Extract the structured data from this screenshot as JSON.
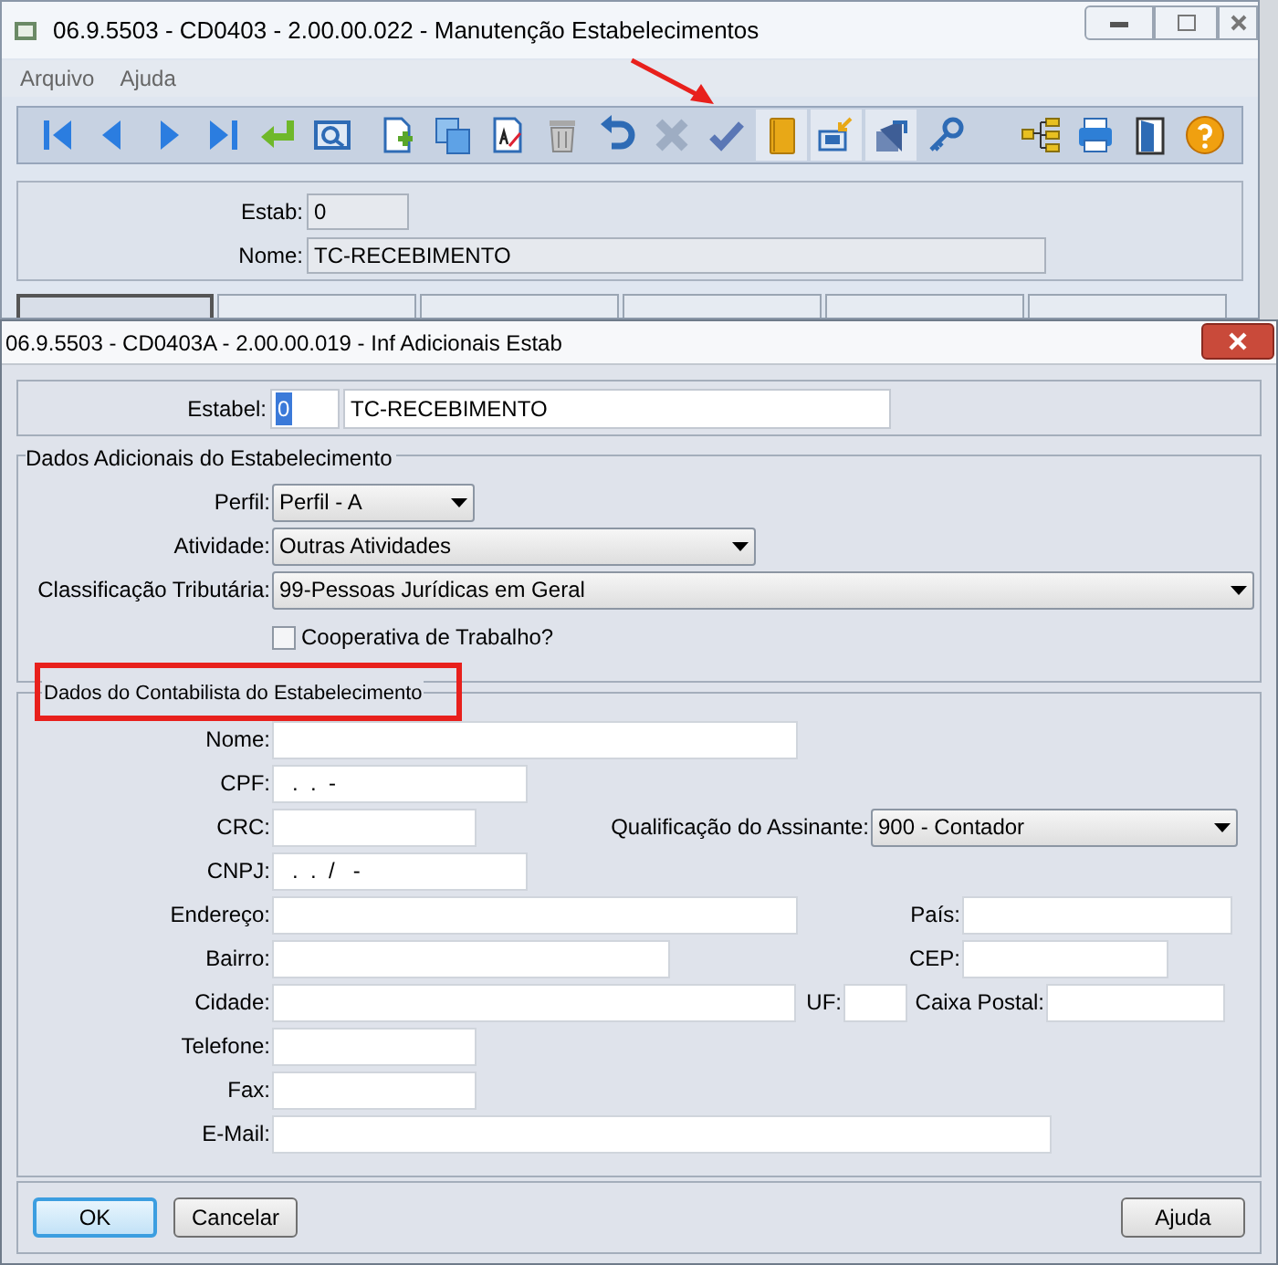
{
  "main_window": {
    "title": "06.9.5503 - CD0403 - 2.00.00.022 - Manutenção Estabelecimentos",
    "menu": [
      "Arquivo",
      "Ajuda"
    ],
    "estab": {
      "label": "Estab:",
      "value": "0"
    },
    "nome": {
      "label": "Nome:",
      "value": "TC-RECEBIMENTO"
    },
    "tabs": [
      {
        "selected": true
      },
      {
        "selected": false
      },
      {
        "selected": false
      },
      {
        "selected": false
      },
      {
        "selected": false
      },
      {
        "selected": false
      }
    ]
  },
  "dialog": {
    "title": "06.9.5503 - CD0403A - 2.00.00.019 - Inf Adicionais Estab",
    "estabel": {
      "label": "Estabel:",
      "code": "0",
      "name": "TC-RECEBIMENTO"
    },
    "adicionais": {
      "title": "Dados Adicionais do Estabelecimento",
      "fields": [
        {
          "label": "Perfil:",
          "value": "Perfil - A"
        },
        {
          "label": "Atividade:",
          "value": "Outras Atividades"
        },
        {
          "label": "Classificação Tributária:",
          "value": "99-Pessoas Jurídicas em Geral"
        }
      ],
      "cooperativa": {
        "label": "Cooperativa de Trabalho?",
        "checked": false
      }
    },
    "contabilista": {
      "title": "Dados do Contabilista do Estabelecimento",
      "highlighted": true,
      "rows": [
        [
          {
            "kind": "input",
            "label": "Nome:"
          }
        ],
        [
          {
            "kind": "input",
            "label": "CPF:",
            "value": ".  .  -"
          }
        ],
        [
          {
            "kind": "input",
            "label": "CRC:"
          },
          {
            "kind": "select",
            "label": "Qualificação do Assinante:",
            "value": "900 - Contador"
          }
        ],
        [
          {
            "kind": "input",
            "label": "CNPJ:",
            "value": ".  .  /   -"
          }
        ],
        [
          {
            "kind": "input",
            "label": "Endereço:"
          },
          {
            "kind": "input",
            "label": "País:"
          }
        ],
        [
          {
            "kind": "input",
            "label": "Bairro:"
          },
          {
            "kind": "input",
            "label": "CEP:"
          }
        ],
        [
          {
            "kind": "input",
            "label": "Cidade:"
          },
          {
            "kind": "input",
            "label": "UF:"
          },
          {
            "kind": "input",
            "label": "Caixa Postal:"
          }
        ],
        [
          {
            "kind": "input",
            "label": "Telefone:"
          }
        ],
        [
          {
            "kind": "input",
            "label": "Fax:"
          }
        ],
        [
          {
            "kind": "input",
            "label": "E-Mail:"
          }
        ]
      ]
    },
    "buttons": [
      {
        "label": "OK",
        "focused": true
      },
      {
        "label": "Cancelar",
        "focused": false
      },
      {
        "label": "Ajuda",
        "focused": false
      }
    ]
  }
}
